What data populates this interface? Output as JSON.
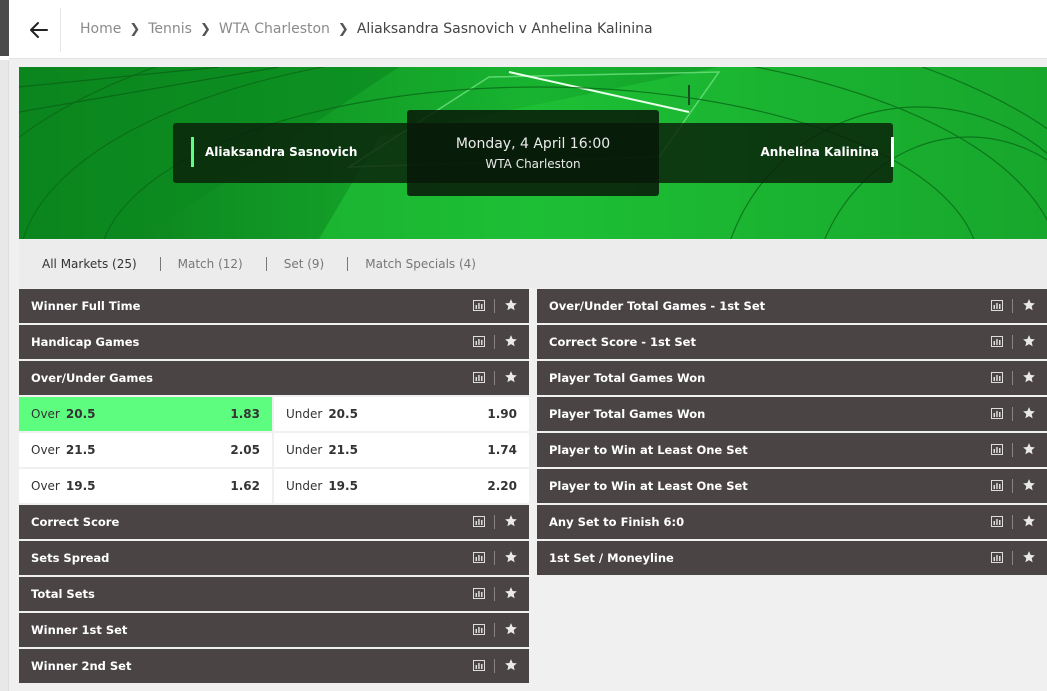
{
  "breadcrumb": {
    "items": [
      "Home",
      "Tennis",
      "WTA Charleston"
    ],
    "current": "Aliaksandra Sasnovich v Anhelina Kalinina"
  },
  "event": {
    "home": "Aliaksandra Sasnovich",
    "away": "Anhelina Kalinina",
    "datetime": "Monday, 4 April 16:00",
    "competition": "WTA Charleston"
  },
  "tabs": [
    "All Markets (25)",
    "Match (12)",
    "Set (9)",
    "Match Specials (4)"
  ],
  "left_markets_top": [
    "Winner Full Time",
    "Handicap Games",
    "Over/Under Games"
  ],
  "over_under_rows": [
    {
      "over_label": "Over",
      "over_line": "20.5",
      "over_price": "1.83",
      "under_label": "Under",
      "under_line": "20.5",
      "under_price": "1.90",
      "selected": "over"
    },
    {
      "over_label": "Over",
      "over_line": "21.5",
      "over_price": "2.05",
      "under_label": "Under",
      "under_line": "21.5",
      "under_price": "1.74",
      "selected": ""
    },
    {
      "over_label": "Over",
      "over_line": "19.5",
      "over_price": "1.62",
      "under_label": "Under",
      "under_line": "19.5",
      "under_price": "2.20",
      "selected": ""
    }
  ],
  "left_markets_bottom": [
    "Correct Score",
    "Sets Spread",
    "Total Sets",
    "Winner 1st Set",
    "Winner 2nd Set"
  ],
  "right_markets": [
    "Over/Under Total Games - 1st Set",
    "Correct Score - 1st Set",
    "Player Total Games Won",
    "Player Total Games Won",
    "Player to Win at Least One Set",
    "Player to Win at Least One Set",
    "Any Set to Finish 6:0",
    "1st Set / Moneyline"
  ],
  "colors": {
    "accent": "#5dfd7f",
    "market_bg": "#4b4445",
    "hero_green": "#0f8d21"
  }
}
